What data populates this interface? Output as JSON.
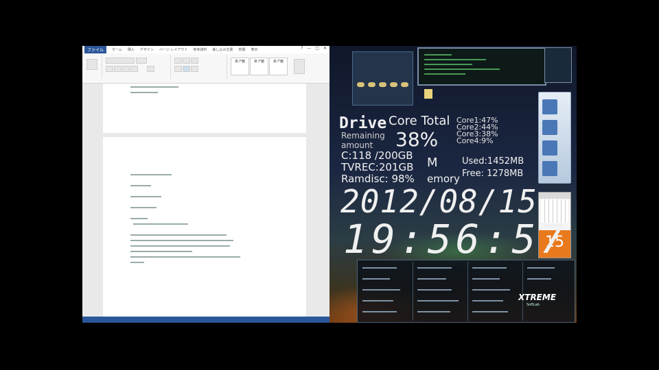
{
  "word": {
    "file_tab": "ファイル",
    "tabs": [
      "ホーム",
      "挿入",
      "デザイン",
      "ページ レイアウト",
      "参考資料",
      "差し込み文書",
      "校閲",
      "表示"
    ],
    "window_controls": [
      "?",
      "—",
      "□",
      "✕"
    ],
    "ribbon_styles": [
      "あア亜",
      "あア亜",
      "あア亜"
    ]
  },
  "desktop": {
    "drive_title": "Drive",
    "remaining": "Remaining",
    "amount": "amount",
    "core_total_label": "Core Total",
    "core_total_value": "38%",
    "cores": [
      "Core1:47%",
      "Core2:44%",
      "Core3:38%",
      "Core4:9%"
    ],
    "drive_c": "C:118 /200GB",
    "drive_tvrec": "TVREC:201GB",
    "ramdisc": "Ramdisc: 98%",
    "memory_m": "M",
    "memory_word": "emory",
    "used": "Used:1452MB",
    "free": "Free: 1278MB",
    "date": "2012/08/15",
    "time": "19:56:57",
    "calendar_day": "15",
    "logo": "XTREME",
    "logo_sub": "SoftLab"
  }
}
